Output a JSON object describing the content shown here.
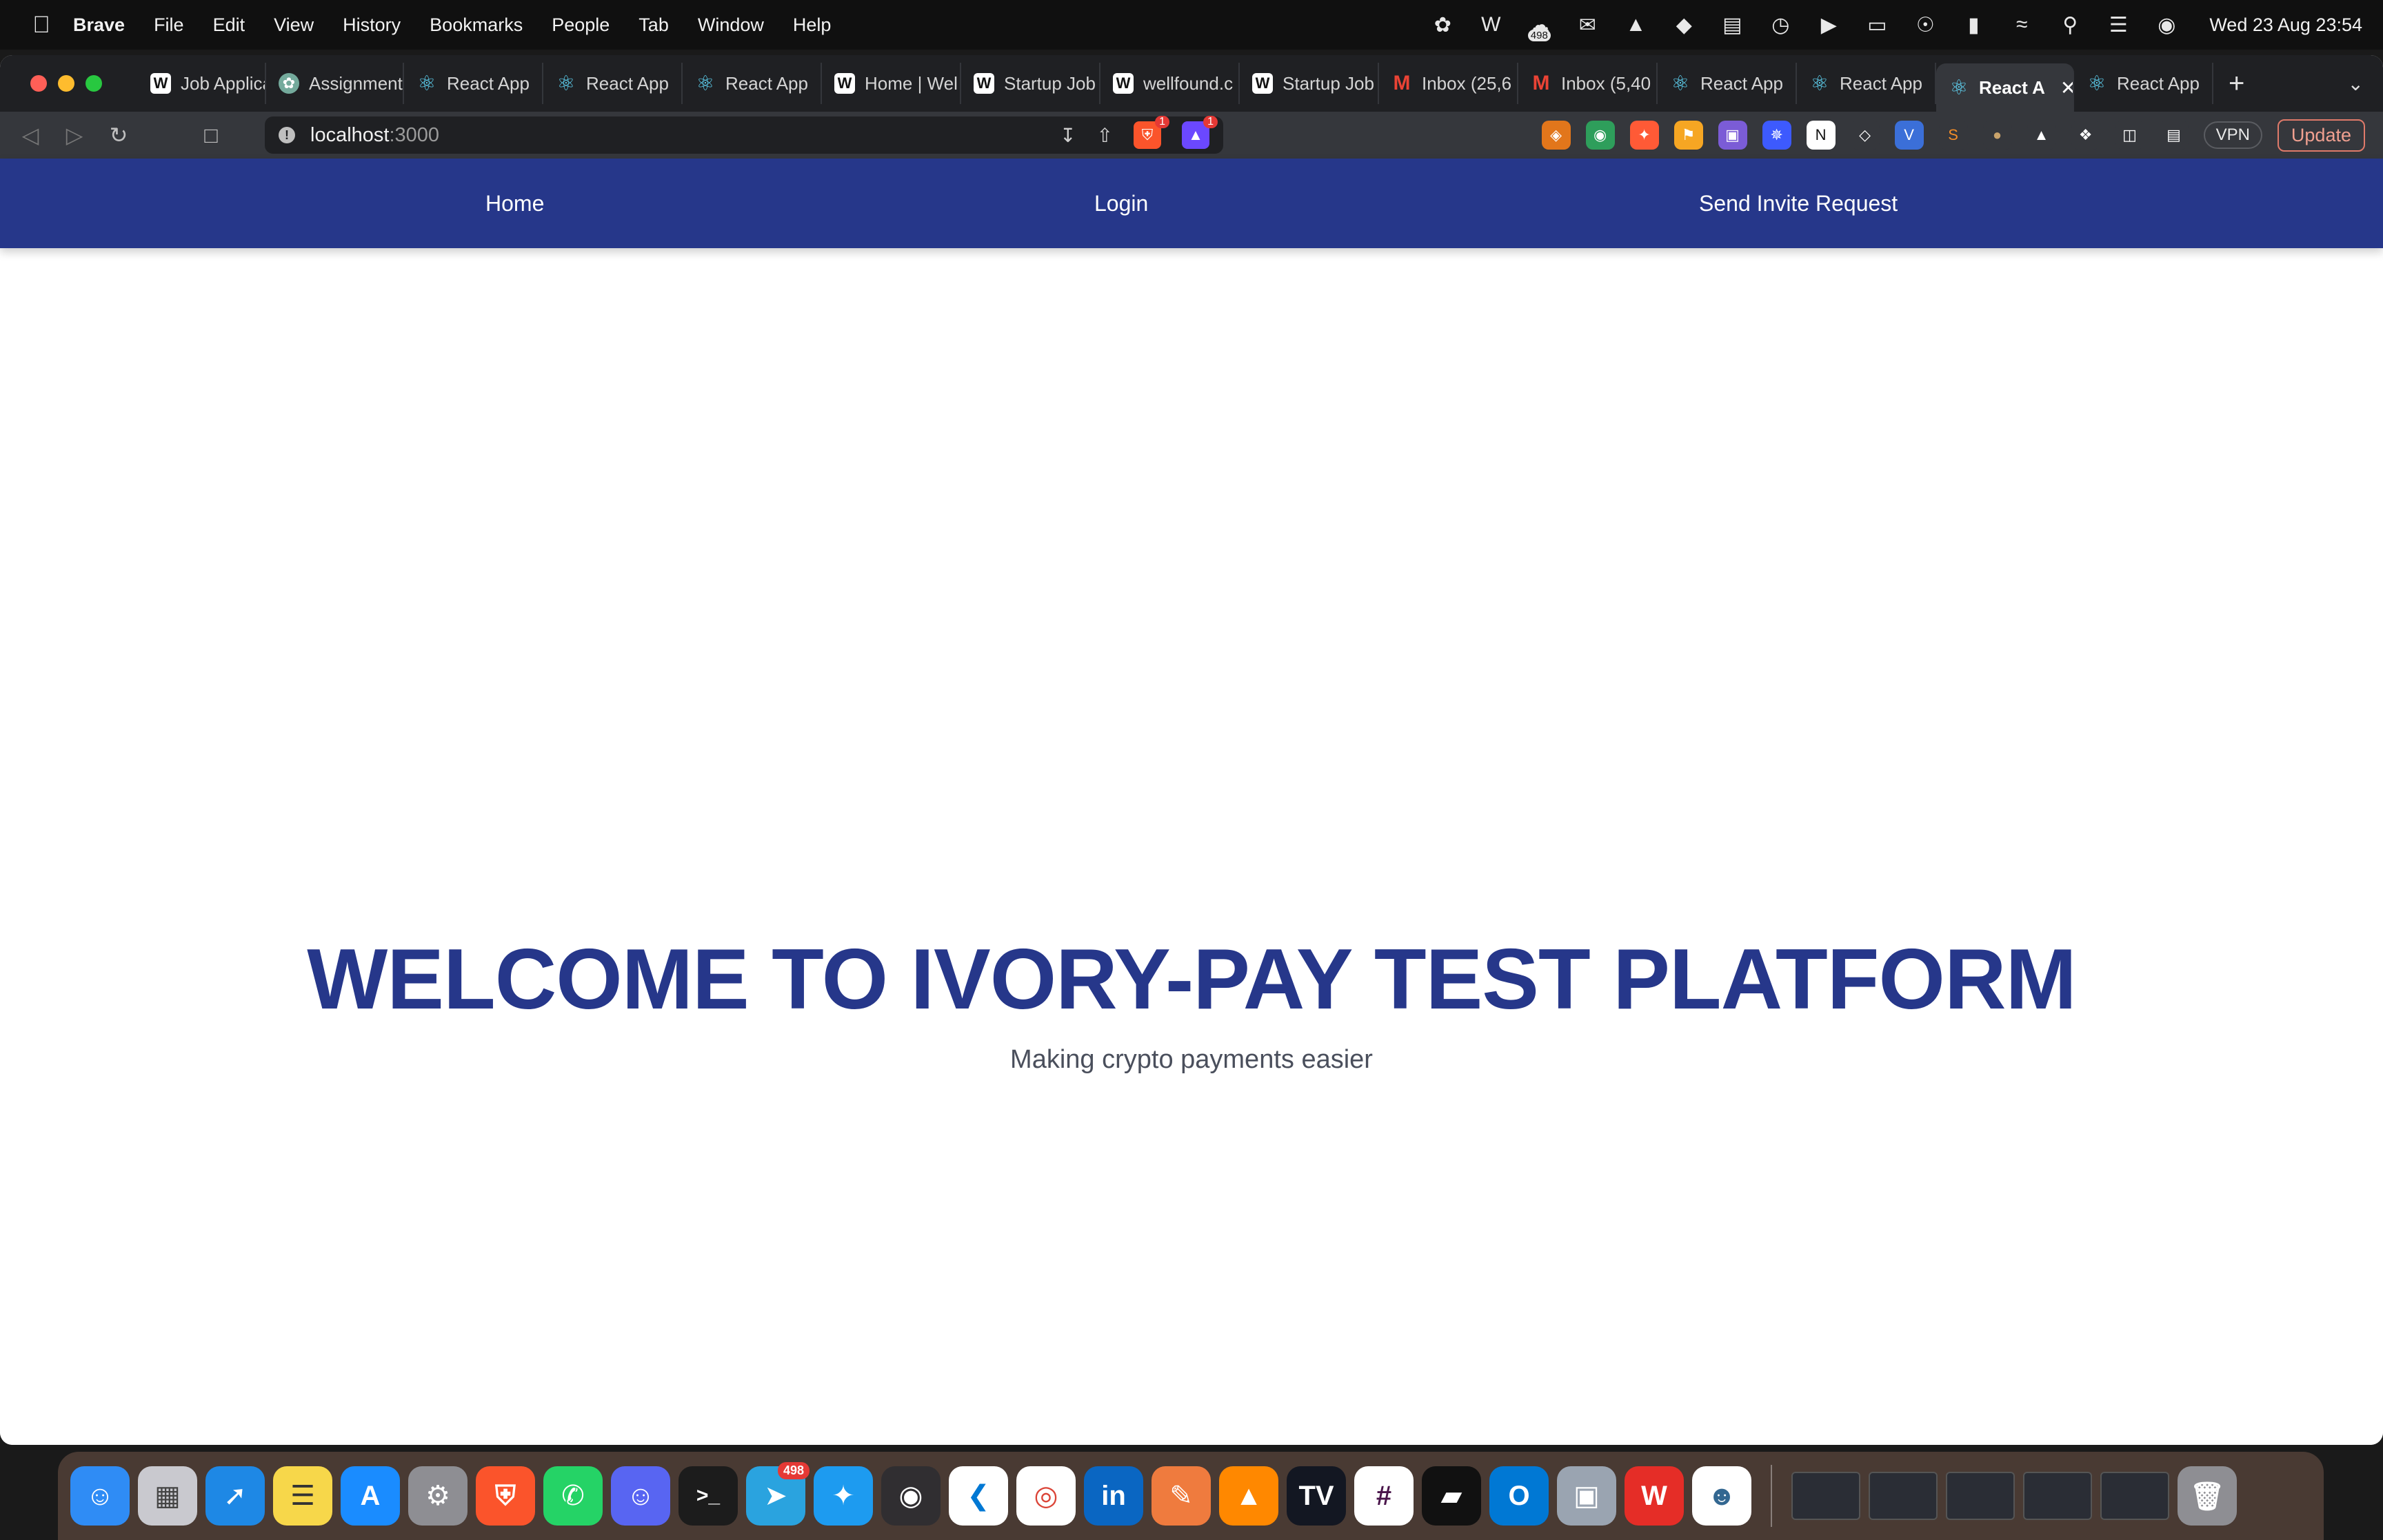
{
  "menubar": {
    "app_name": "Brave",
    "menus": [
      "File",
      "Edit",
      "View",
      "History",
      "Bookmarks",
      "People",
      "Tab",
      "Window",
      "Help"
    ],
    "status_badge": "498",
    "clock": "Wed 23 Aug  23:54"
  },
  "tabs": [
    {
      "label": "Job Applica",
      "icon": "wellfound-icon"
    },
    {
      "label": "Assignment",
      "icon": "chatgpt-icon"
    },
    {
      "label": "React App",
      "icon": "react-icon"
    },
    {
      "label": "React App",
      "icon": "react-icon"
    },
    {
      "label": "React App",
      "icon": "react-icon"
    },
    {
      "label": "Home | Wel",
      "icon": "wellfound-icon"
    },
    {
      "label": "Startup Job",
      "icon": "wellfound-icon"
    },
    {
      "label": "wellfound.c",
      "icon": "wellfound-icon"
    },
    {
      "label": "Startup Job",
      "icon": "wellfound-icon"
    },
    {
      "label": "Inbox (25,6",
      "icon": "gmail-icon"
    },
    {
      "label": "Inbox (5,40",
      "icon": "gmail-icon"
    },
    {
      "label": "React App",
      "icon": "react-icon"
    },
    {
      "label": "React App",
      "icon": "react-icon"
    },
    {
      "label": "React A",
      "icon": "react-icon",
      "active": true
    },
    {
      "label": "React App",
      "icon": "react-icon"
    }
  ],
  "address": {
    "host": "localhost",
    "port": ":3000",
    "shield_badge": "1",
    "rewards_badge": "1"
  },
  "toolbar": {
    "vpn_label": "VPN",
    "update_label": "Update"
  },
  "app": {
    "nav": {
      "home": "Home",
      "login": "Login",
      "invite": "Send Invite Request"
    },
    "hero": {
      "title": "WELCOME TO IVORY-PAY TEST PLATFORM",
      "subtitle": "Making crypto payments easier"
    },
    "colors": {
      "nav_bg": "#26378a",
      "title": "#26378a"
    }
  },
  "dock": {
    "telegram_badge": "498"
  }
}
